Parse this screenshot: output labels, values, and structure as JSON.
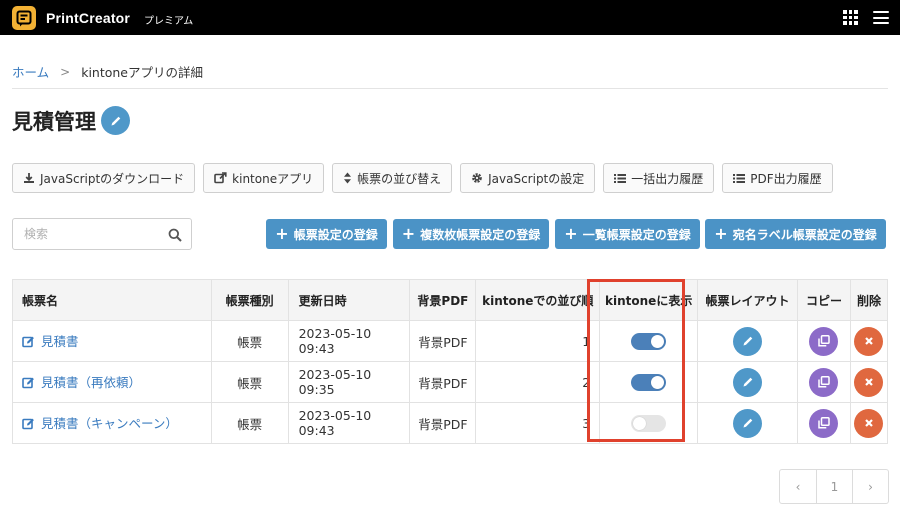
{
  "app": {
    "brand": "PrintCreator",
    "plan": "プレミアム"
  },
  "breadcrumb": {
    "home": "ホーム",
    "separator": ">",
    "current": "kintoneアプリの詳細"
  },
  "page": {
    "title": "見積管理"
  },
  "toolbar": [
    {
      "label": "JavaScriptのダウンロード",
      "icon": "download-icon"
    },
    {
      "label": "kintoneアプリ",
      "icon": "external-link-icon"
    },
    {
      "label": "帳票の並び替え",
      "icon": "sort-icon"
    },
    {
      "label": "JavaScriptの設定",
      "icon": "gear-icon"
    },
    {
      "label": "一括出力履歴",
      "icon": "list-icon"
    },
    {
      "label": "PDF出力履歴",
      "icon": "list-icon"
    }
  ],
  "search": {
    "placeholder": "検索",
    "value": ""
  },
  "actions": [
    {
      "label": "帳票設定の登録"
    },
    {
      "label": "複数枚帳票設定の登録"
    },
    {
      "label": "一覧帳票設定の登録"
    },
    {
      "label": "宛名ラベル帳票設定の登録"
    }
  ],
  "table": {
    "columns": [
      "帳票名",
      "帳票種別",
      "更新日時",
      "背景PDF",
      "kintoneでの並び順",
      "kintoneに表示",
      "帳票レイアウト",
      "コピー",
      "削除"
    ],
    "rows": [
      {
        "name": "見積書",
        "type": "帳票",
        "updated": "2023-05-10 09:43",
        "bg_pdf": "背景PDF",
        "order": "1",
        "visible": true
      },
      {
        "name": "見積書（再依頼）",
        "type": "帳票",
        "updated": "2023-05-10 09:35",
        "bg_pdf": "背景PDF",
        "order": "2",
        "visible": true
      },
      {
        "name": "見積書（キャンペーン）",
        "type": "帳票",
        "updated": "2023-05-10 09:43",
        "bg_pdf": "背景PDF",
        "order": "3",
        "visible": false
      }
    ]
  },
  "pagination": {
    "prev": "‹",
    "current": "1",
    "next": "›"
  },
  "colors": {
    "header_bg": "#000000",
    "logo": "#f2b134",
    "primary": "#4b93c6",
    "link": "#3a7bbf",
    "toggle_on": "#4b80b9",
    "copy": "#8c6bc8",
    "delete": "#e0683f",
    "highlight": "#e0412d"
  }
}
